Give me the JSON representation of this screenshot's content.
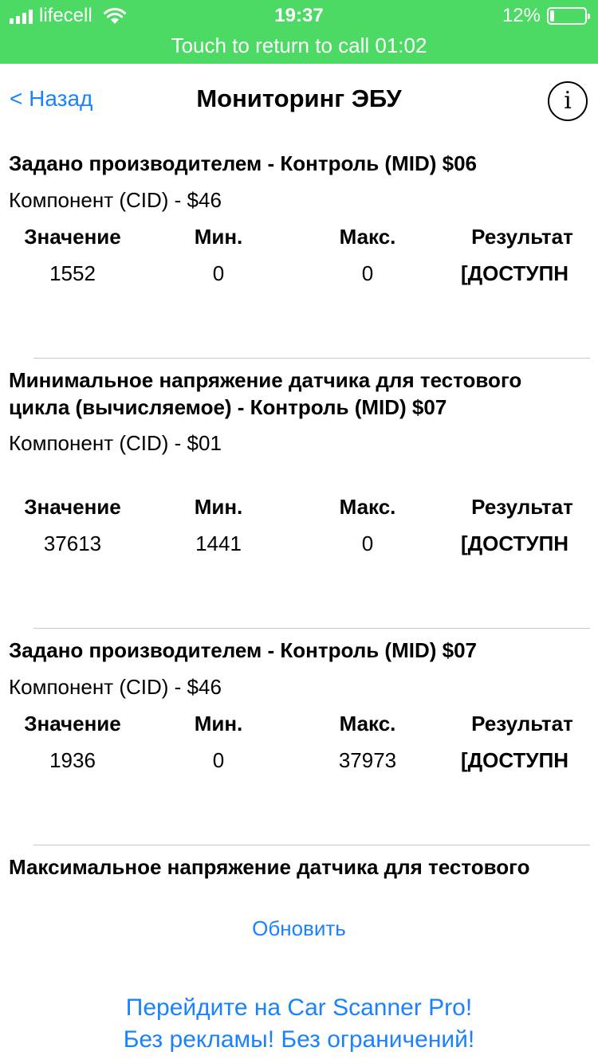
{
  "status_bar": {
    "carrier": "lifecell",
    "time": "19:37",
    "battery_percent": "12%",
    "battery_level": 0.12,
    "call_banner": "Touch to return to call 01:02"
  },
  "nav": {
    "back_label": "< Назад",
    "title": "Мониторинг ЭБУ",
    "info_label": "i"
  },
  "columns": {
    "value": "Значение",
    "min": "Мин.",
    "max": "Макс.",
    "result": "Результат"
  },
  "items": [
    {
      "title": "Задано производителем - Контроль (MID) $06",
      "cid": "Компонент (CID) - $46",
      "value": "1552",
      "min": "0",
      "max": "0",
      "result": "[ДОСТУПН"
    },
    {
      "title": "Минимальное напряжение датчика для тестового цикла (вычисляемое) - Контроль (MID) $07",
      "cid": "Компонент (CID) - $01",
      "value": "37613",
      "min": "1441",
      "max": "0",
      "result": "[ДОСТУПН"
    },
    {
      "title": "Задано производителем - Контроль (MID) $07",
      "cid": "Компонент (CID) - $46",
      "value": "1936",
      "min": "0",
      "max": "37973",
      "result": "[ДОСТУПН"
    },
    {
      "title": "Максимальное напряжение датчика для тестового"
    }
  ],
  "refresh_label": "Обновить",
  "promo": {
    "line1": "Перейдите на Car Scanner Pro!",
    "line2": "Без рекламы! Без ограничений!"
  },
  "colors": {
    "status_green": "#4cd964",
    "link_blue": "#1a82fb"
  }
}
